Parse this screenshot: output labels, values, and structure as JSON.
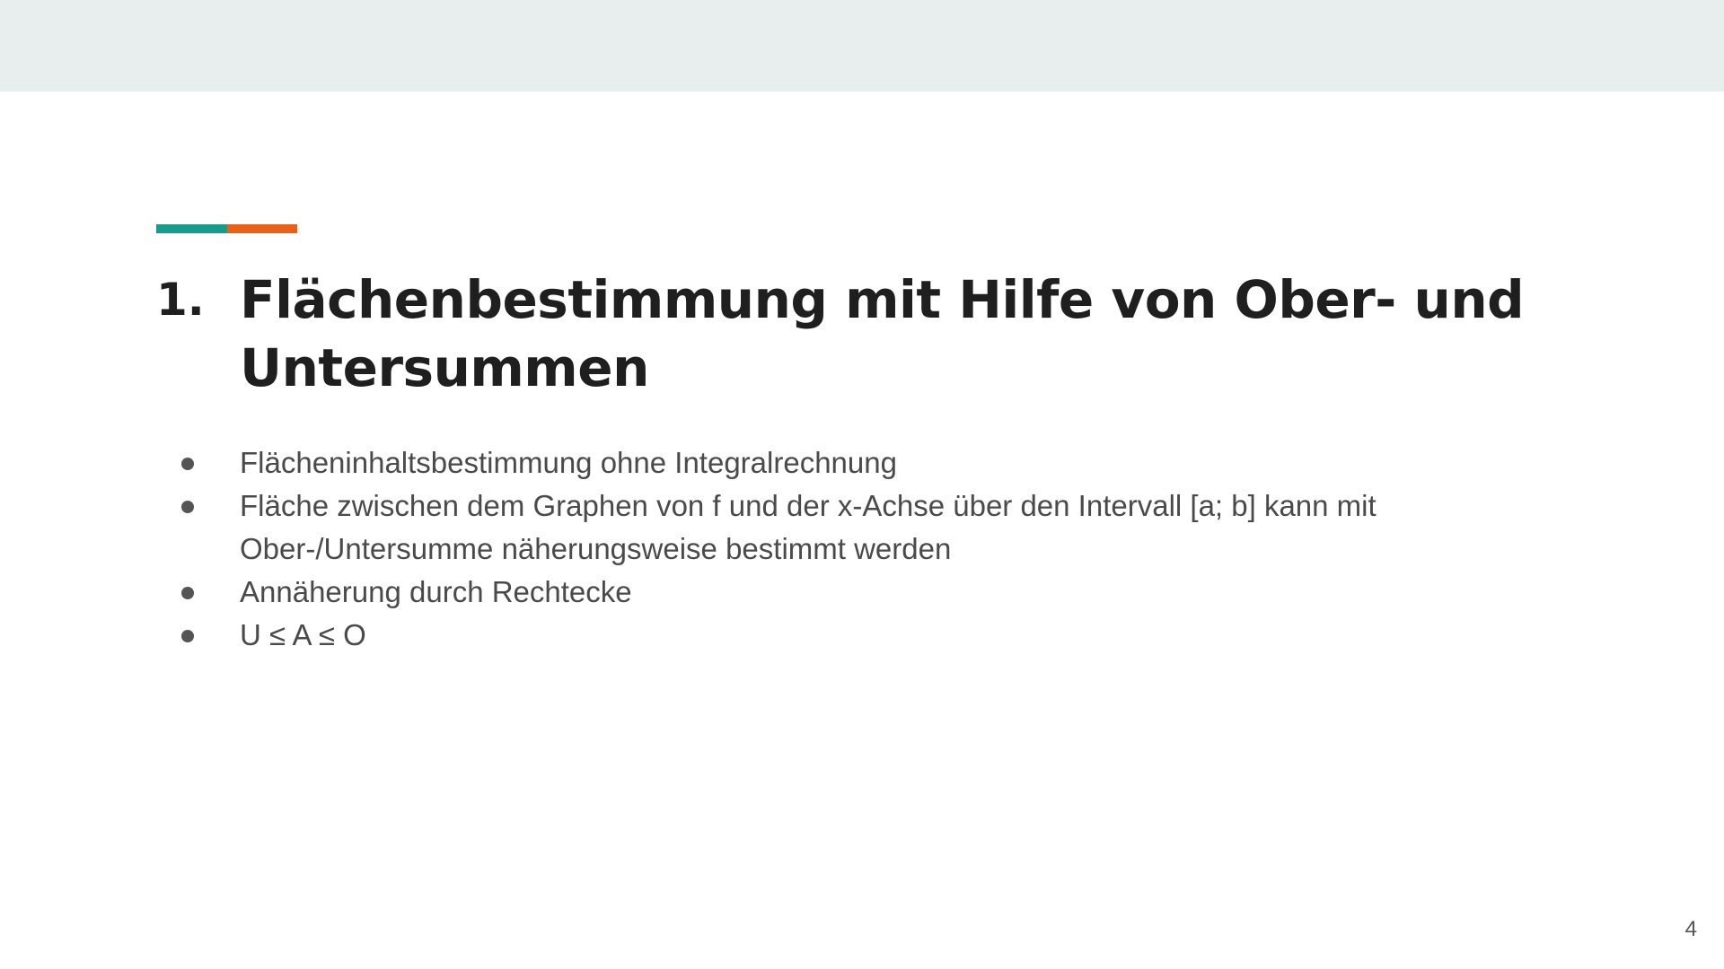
{
  "colors": {
    "top_band": "#e8eeee",
    "accent_teal": "#1a9a8a",
    "accent_orange": "#e8601a",
    "bullet_dot": "#555555"
  },
  "slide": {
    "title_number": "1.",
    "title_line1": "Flächenbestimmung mit Hilfe von Ober- und",
    "title_line2": "Untersummen",
    "bullets": [
      "Flächeninhaltsbestimmung ohne Integralrechnung",
      "Fläche zwischen dem Graphen von f und der x-Achse über den Intervall [a; b] kann mit Ober-/Untersumme näherungsweise bestimmt werden",
      "Annäherung durch Rechtecke",
      "U ≤ A ≤ O"
    ],
    "page_number": "4"
  }
}
